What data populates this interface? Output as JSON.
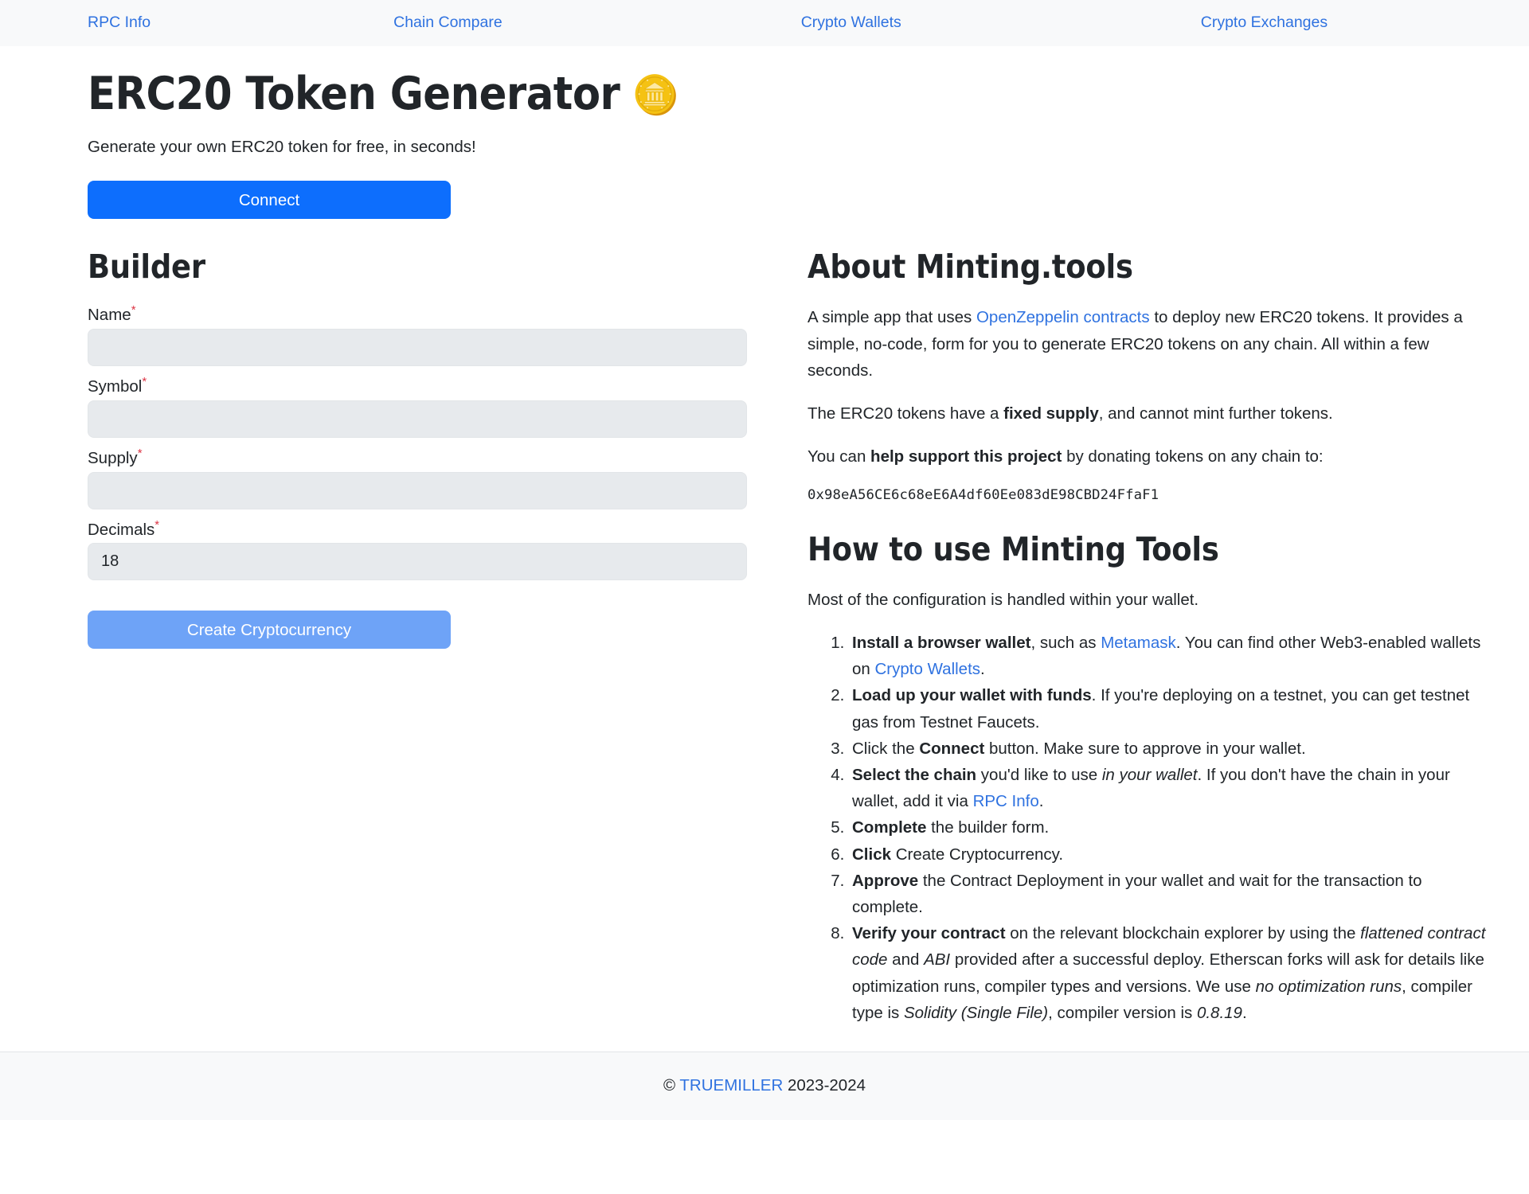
{
  "nav": {
    "items": [
      {
        "label": "RPC Info",
        "name": "nav-link-rpc-info"
      },
      {
        "label": "Chain Compare",
        "name": "nav-link-chain-compare"
      },
      {
        "label": "Crypto Wallets",
        "name": "nav-link-crypto-wallets"
      },
      {
        "label": "Crypto Exchanges",
        "name": "nav-link-crypto-exchanges"
      }
    ]
  },
  "header": {
    "title": "ERC20 Token Generator",
    "title_icon": "coin-icon",
    "subtitle": "Generate your own ERC20 token for free, in seconds!",
    "connect_label": "Connect"
  },
  "builder": {
    "heading": "Builder",
    "required_marker": "*",
    "fields": [
      {
        "label": "Name",
        "value": "",
        "placeholder": "",
        "required": true,
        "name": "name-field"
      },
      {
        "label": "Symbol",
        "value": "",
        "placeholder": "",
        "required": true,
        "name": "symbol-field"
      },
      {
        "label": "Supply",
        "value": "",
        "placeholder": "",
        "required": true,
        "name": "supply-field"
      },
      {
        "label": "Decimals",
        "value": "18",
        "placeholder": "",
        "required": true,
        "name": "decimals-field"
      }
    ],
    "submit_label": "Create Cryptocurrency"
  },
  "about": {
    "heading": "About Minting.tools",
    "p1_a": "A simple app that uses ",
    "p1_link": "OpenZeppelin contracts",
    "p1_b": " to deploy new ERC20 tokens. It provides a simple, no-code, form for you to generate ERC20 tokens on any chain. All within a few seconds.",
    "p2_a": "The ERC20 tokens have a ",
    "p2_bold": "fixed supply",
    "p2_b": ", and cannot mint further tokens.",
    "p3_a": "You can ",
    "p3_bold": "help support this project",
    "p3_b": " by donating tokens on any chain to:",
    "donation_address": "0x98eA56CE6c68eE6A4df60Ee083dE98CBD24FfaF1"
  },
  "howto": {
    "heading": "How to use Minting Tools",
    "intro": "Most of the configuration is handled within your wallet.",
    "steps": {
      "s1_bold": "Install a browser wallet",
      "s1_a": ", such as ",
      "s1_link1": "Metamask",
      "s1_b": ". You can find other Web3-enabled wallets on ",
      "s1_link2": "Crypto Wallets",
      "s1_c": ".",
      "s2_bold": "Load up your wallet with funds",
      "s2_a": ". If you're deploying on a testnet, you can get testnet gas from Testnet Faucets.",
      "s3_a": "Click the ",
      "s3_bold": "Connect",
      "s3_b": " button. Make sure to approve in your wallet.",
      "s4_bold": "Select the chain",
      "s4_a": " you'd like to use ",
      "s4_italic": "in your wallet",
      "s4_b": ". If you don't have the chain in your wallet, add it via ",
      "s4_link": "RPC Info",
      "s4_c": ".",
      "s5_bold": "Complete",
      "s5_a": " the builder form.",
      "s6_bold": "Click",
      "s6_a": " Create Cryptocurrency.",
      "s7_bold": "Approve",
      "s7_a": " the Contract Deployment in your wallet and wait for the transaction to complete.",
      "s8_bold": "Verify your contract",
      "s8_a": " on the relevant blockchain explorer by using the ",
      "s8_italic1": "flattened contract code",
      "s8_b": " and ",
      "s8_italic2": "ABI",
      "s8_c": " provided after a successful deploy. Etherscan forks will ask for details like optimization runs, compiler types and versions. We use ",
      "s8_italic3": "no optimization runs",
      "s8_d": ", compiler type is ",
      "s8_italic4": "Solidity (Single File)",
      "s8_e": ", compiler version is ",
      "s8_italic5": "0.8.19",
      "s8_f": "."
    }
  },
  "footer": {
    "copyright_symbol": "©",
    "brand": "TRUEMILLER",
    "years": "2023-2024"
  },
  "colors": {
    "primary": "#0d6efd",
    "link": "#2f72e0",
    "disabled_button": "#6ea3f7",
    "input_bg": "#e7eaed",
    "nav_bg": "#f8f9fa",
    "required_star": "#dc3545",
    "coin_gold": "#f6c612"
  }
}
